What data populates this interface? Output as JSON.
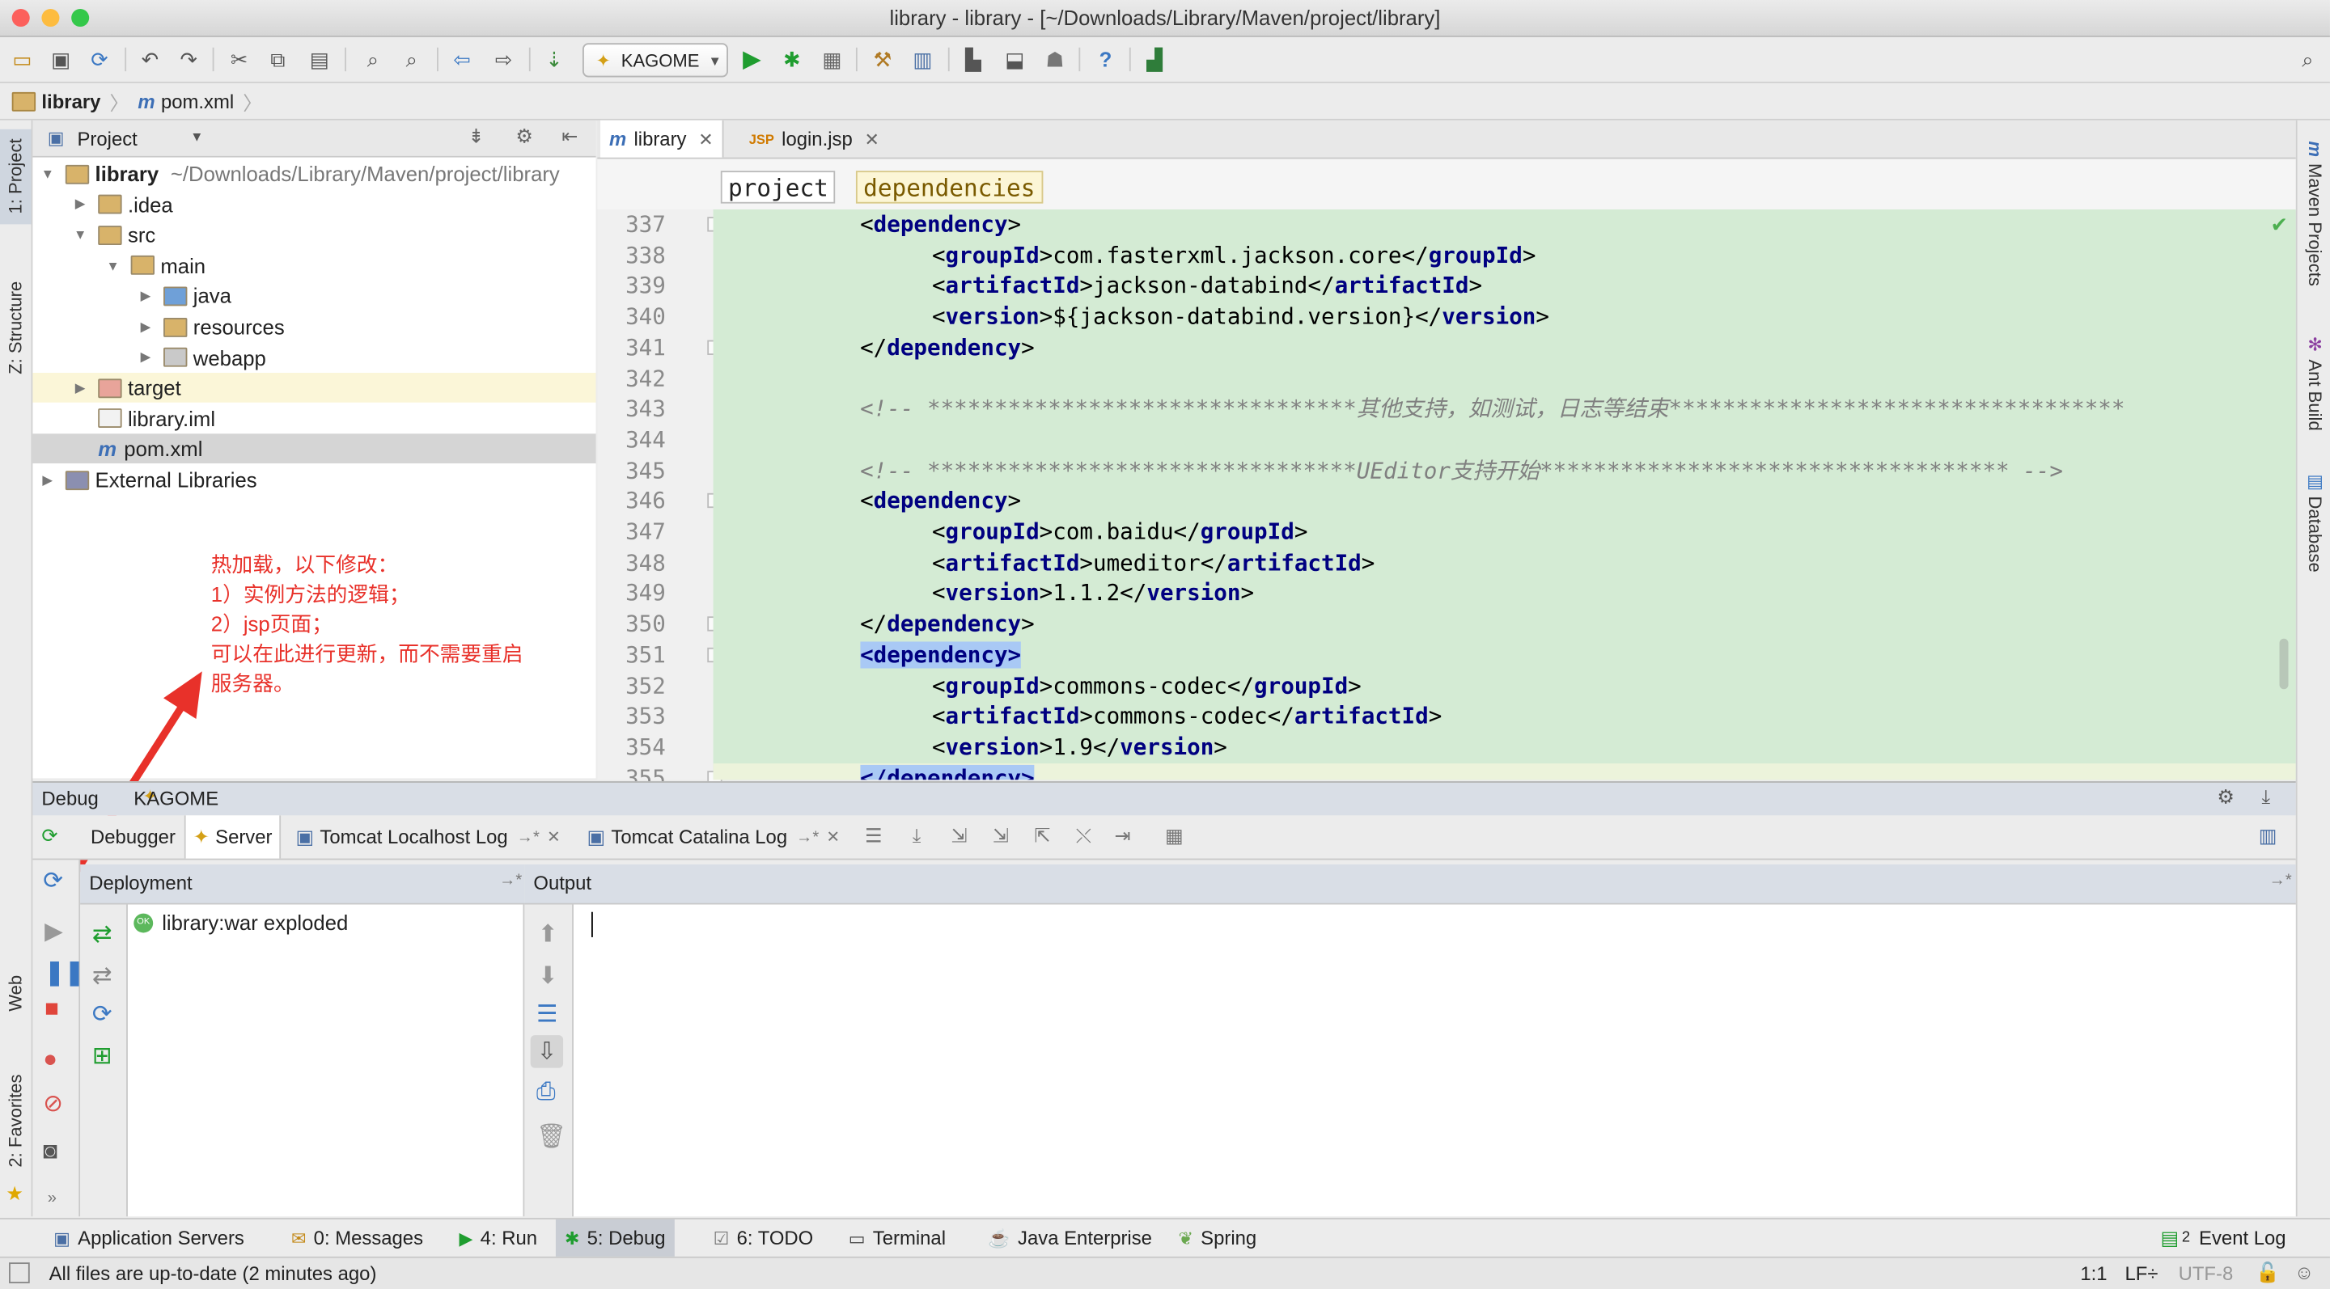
{
  "window": {
    "title": "library - library - [~/Downloads/Library/Maven/project/library]",
    "traffic_colors": [
      "#fc605c",
      "#fdbc40",
      "#34c84a"
    ]
  },
  "toolbar": {
    "run_config": "KAGOME",
    "icons": [
      "open-icon",
      "save-icon",
      "sync-icon",
      "undo-icon",
      "redo-icon",
      "cut-icon",
      "copy-icon",
      "paste-icon",
      "find-icon",
      "replace-icon",
      "back-icon",
      "forward-icon",
      "make-icon",
      "run-icon",
      "debug-icon",
      "coverage-icon",
      "settings-icon",
      "structure-icon",
      "sdk-icon",
      "android-icon",
      "help-icon",
      "vcs-icon",
      "search-icon"
    ]
  },
  "navbar": {
    "crumbs": [
      "library",
      "pom.xml"
    ]
  },
  "left_strip": {
    "tabs": [
      "1: Project",
      "Z: Structure",
      "Web",
      "2: Favorites"
    ]
  },
  "right_strip": {
    "tabs": [
      "Maven Projects",
      "Ant Build",
      "Database"
    ]
  },
  "project_pane": {
    "view_label": "Project",
    "tree": [
      {
        "label": "library",
        "hint": "~/Downloads/Library/Maven/project/library",
        "depth": 0,
        "expanded": true,
        "icon": "module-folder"
      },
      {
        "label": ".idea",
        "depth": 1,
        "expanded": false,
        "icon": "folder"
      },
      {
        "label": "src",
        "depth": 1,
        "expanded": true,
        "icon": "folder"
      },
      {
        "label": "main",
        "depth": 2,
        "expanded": true,
        "icon": "folder"
      },
      {
        "label": "java",
        "depth": 3,
        "expanded": false,
        "icon": "source-folder"
      },
      {
        "label": "resources",
        "depth": 3,
        "expanded": false,
        "icon": "resource-folder"
      },
      {
        "label": "webapp",
        "depth": 3,
        "expanded": false,
        "icon": "web-folder"
      },
      {
        "label": "target",
        "depth": 1,
        "expanded": false,
        "icon": "excluded-folder"
      },
      {
        "label": "library.iml",
        "depth": 1,
        "icon": "iml-file"
      },
      {
        "label": "pom.xml",
        "depth": 1,
        "icon": "maven-file",
        "selected": true
      },
      {
        "label": "External Libraries",
        "depth": 0,
        "expanded": false,
        "icon": "libraries"
      }
    ]
  },
  "annotation": {
    "lines": [
      "热加载，以下修改：",
      "1）实例方法的逻辑；",
      "2）jsp页面；",
      "可以在此进行更新，而不需要重启",
      "服务器。"
    ],
    "color": "#e8312a"
  },
  "editor": {
    "tabs": [
      {
        "label": "library",
        "active": true
      },
      {
        "label": "login.jsp",
        "active": false
      }
    ],
    "breadcrumbs": [
      "project",
      "dependencies"
    ],
    "lines": [
      {
        "n": "337",
        "indent": 8,
        "parts": [
          [
            "p",
            "<"
          ],
          [
            "t",
            "dependency"
          ],
          [
            "p",
            ">"
          ]
        ]
      },
      {
        "n": "338",
        "indent": 12,
        "parts": [
          [
            "p",
            "<"
          ],
          [
            "t",
            "groupId"
          ],
          [
            "p",
            ">com.fasterxml.jackson.core</"
          ],
          [
            "t",
            "groupId"
          ],
          [
            "p",
            ">"
          ]
        ]
      },
      {
        "n": "339",
        "indent": 12,
        "parts": [
          [
            "p",
            "<"
          ],
          [
            "t",
            "artifactId"
          ],
          [
            "p",
            ">jackson-databind</"
          ],
          [
            "t",
            "artifactId"
          ],
          [
            "p",
            ">"
          ]
        ]
      },
      {
        "n": "340",
        "indent": 12,
        "parts": [
          [
            "p",
            "<"
          ],
          [
            "t",
            "version"
          ],
          [
            "p",
            ">${jackson-databind.version}</"
          ],
          [
            "t",
            "version"
          ],
          [
            "p",
            ">"
          ]
        ]
      },
      {
        "n": "341",
        "indent": 8,
        "parts": [
          [
            "p",
            "</"
          ],
          [
            "t",
            "dependency"
          ],
          [
            "p",
            ">"
          ]
        ]
      },
      {
        "n": "342",
        "indent": 0,
        "parts": []
      },
      {
        "n": "343",
        "indent": 8,
        "parts": [
          [
            "c",
            "<!-- ********************************其他支持，如测试，日志等结束**********************************"
          ]
        ]
      },
      {
        "n": "344",
        "indent": 0,
        "parts": []
      },
      {
        "n": "345",
        "indent": 8,
        "parts": [
          [
            "c",
            "<!-- ********************************UEditor支持开始*********************************** -->"
          ]
        ]
      },
      {
        "n": "346",
        "indent": 8,
        "parts": [
          [
            "p",
            "<"
          ],
          [
            "t",
            "dependency"
          ],
          [
            "p",
            ">"
          ]
        ]
      },
      {
        "n": "347",
        "indent": 12,
        "parts": [
          [
            "p",
            "<"
          ],
          [
            "t",
            "groupId"
          ],
          [
            "p",
            ">com.baidu</"
          ],
          [
            "t",
            "groupId"
          ],
          [
            "p",
            ">"
          ]
        ]
      },
      {
        "n": "348",
        "indent": 12,
        "parts": [
          [
            "p",
            "<"
          ],
          [
            "t",
            "artifactId"
          ],
          [
            "p",
            ">umeditor</"
          ],
          [
            "t",
            "artifactId"
          ],
          [
            "p",
            ">"
          ]
        ]
      },
      {
        "n": "349",
        "indent": 12,
        "parts": [
          [
            "p",
            "<"
          ],
          [
            "t",
            "version"
          ],
          [
            "p",
            ">1.1.2</"
          ],
          [
            "t",
            "version"
          ],
          [
            "p",
            ">"
          ]
        ]
      },
      {
        "n": "350",
        "indent": 8,
        "parts": [
          [
            "p",
            "</"
          ],
          [
            "t",
            "dependency"
          ],
          [
            "p",
            ">"
          ]
        ]
      },
      {
        "n": "351",
        "indent": 8,
        "parts": [
          [
            "h",
            "<dependency>"
          ]
        ]
      },
      {
        "n": "352",
        "indent": 12,
        "parts": [
          [
            "p",
            "<"
          ],
          [
            "t",
            "groupId"
          ],
          [
            "p",
            ">commons-codec</"
          ],
          [
            "t",
            "groupId"
          ],
          [
            "p",
            ">"
          ]
        ]
      },
      {
        "n": "353",
        "indent": 12,
        "parts": [
          [
            "p",
            "<"
          ],
          [
            "t",
            "artifactId"
          ],
          [
            "p",
            ">commons-codec</"
          ],
          [
            "t",
            "artifactId"
          ],
          [
            "p",
            ">"
          ]
        ]
      },
      {
        "n": "354",
        "indent": 12,
        "parts": [
          [
            "p",
            "<"
          ],
          [
            "t",
            "version"
          ],
          [
            "p",
            ">1.9</"
          ],
          [
            "t",
            "version"
          ],
          [
            "p",
            ">"
          ]
        ]
      },
      {
        "n": "355",
        "indent": 8,
        "parts": [
          [
            "h",
            "</dependency>"
          ]
        ]
      }
    ]
  },
  "debug": {
    "label": "Debug",
    "config": "KAGOME",
    "tabs": [
      "Debugger",
      "Server",
      "Tomcat Localhost Log",
      "Tomcat Catalina Log"
    ],
    "deployment_header": "Deployment",
    "output_header": "Output",
    "deployments": [
      {
        "label": "library:war exploded",
        "status": "OK"
      }
    ]
  },
  "bottom_tabs": [
    {
      "label": "Application Servers",
      "icon": "server-icon"
    },
    {
      "label": "0: Messages",
      "icon": "messages-icon"
    },
    {
      "label": "4: Run",
      "icon": "run-icon"
    },
    {
      "label": "5: Debug",
      "icon": "debug-icon",
      "active": true
    },
    {
      "label": "6: TODO",
      "icon": "todo-icon"
    },
    {
      "label": "Terminal",
      "icon": "terminal-icon"
    },
    {
      "label": "Java Enterprise",
      "icon": "java-ee-icon"
    },
    {
      "label": "Spring",
      "icon": "spring-icon"
    }
  ],
  "event_log": {
    "count": "2",
    "label": "Event Log"
  },
  "status": {
    "message": "All files are up-to-date (2 minutes ago)",
    "position": "1:1",
    "line_sep": "LF÷",
    "encoding": "UTF-8"
  }
}
